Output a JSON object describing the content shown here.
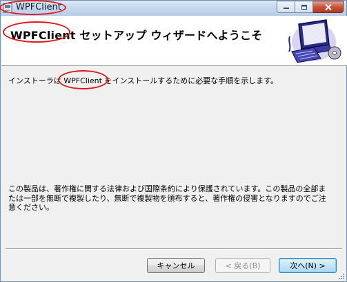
{
  "window": {
    "title": "WPFClient",
    "caption_buttons": [
      "minimize",
      "maximize",
      "close"
    ]
  },
  "header": {
    "title": "WPFClient セットアップ ウィザードへようこそ",
    "art_icon": "computer-setup-icon"
  },
  "body": {
    "intro_prefix": "インストーラは ",
    "intro_highlight": "WPFClient",
    "intro_suffix": " をインストールするために必要な手順を示します。",
    "copyright_notice": "この製品は、著作権に関する法律および国際条約により保護されています。この製品の全部または一部を無断で複製したり、無断で複製物を頒布すると、著作権の侵害となりますのでご注意ください。"
  },
  "footer": {
    "cancel_label": "キャンセル",
    "back_label": "< 戻る(B)",
    "next_label": "次へ(N) >",
    "back_enabled": false
  },
  "annotation_color": "#e01818"
}
